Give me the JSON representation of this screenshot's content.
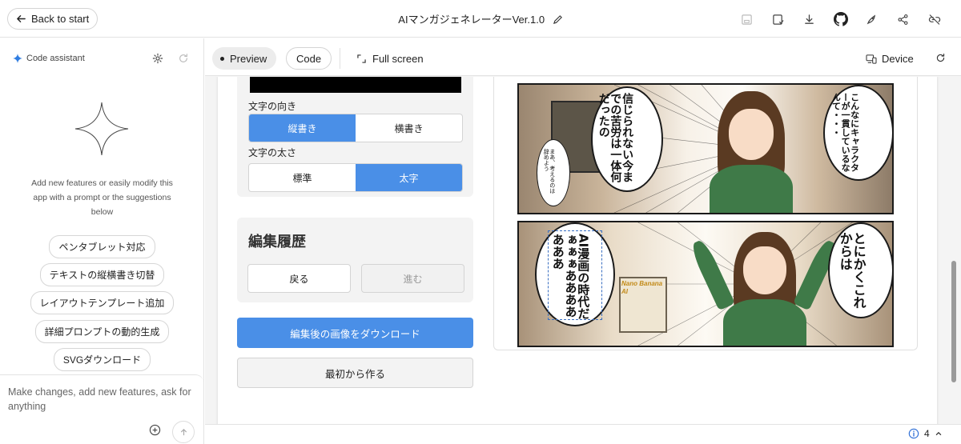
{
  "topbar": {
    "back_label": "Back to start",
    "title": "AIマンガジェネレーターVer.1.0",
    "icons": [
      "save-icon",
      "save-as-icon",
      "download-icon",
      "github-icon",
      "deploy-rocket-icon",
      "share-icon",
      "link-off-icon"
    ]
  },
  "assistant": {
    "header": "Code assistant",
    "description": "Add new features or easily modify this app with a prompt or the suggestions below",
    "suggestions": [
      "ペンタブレット対応",
      "テキストの縦横書き切替",
      "レイアウトテンプレート追加",
      "詳細プロンプトの動的生成",
      "SVGダウンロード"
    ],
    "prompt_placeholder": "Make changes, add new features, ask for anything"
  },
  "toolbar": {
    "preview_label": "Preview",
    "code_label": "Code",
    "fullscreen_label": "Full screen",
    "device_label": "Device"
  },
  "editor": {
    "direction_label": "文字の向き",
    "direction_options": [
      "縦書き",
      "横書き"
    ],
    "direction_selected": "縦書き",
    "weight_label": "文字の太さ",
    "weight_options": [
      "標準",
      "太字"
    ],
    "weight_selected": "太字",
    "history_title": "編集履歴",
    "undo_label": "戻る",
    "redo_label": "進む",
    "download_label": "編集後の画像をダウンロード",
    "restart_label": "最初から作る"
  },
  "manga": {
    "panel2": {
      "bubble_left": "信じられない今までの苦労は一体何だったの",
      "bubble_small": "まあ、考えるのは辞めよう",
      "bubble_right": "こんなにキャラクターが一貫しているなんて・・・"
    },
    "panel3": {
      "caption": "AI漫画の時代だぁぁぁあああああああ",
      "bubble_right": "とにかくこれからは",
      "sign_text": "Nano Banana AI"
    }
  },
  "status": {
    "count": "4"
  }
}
